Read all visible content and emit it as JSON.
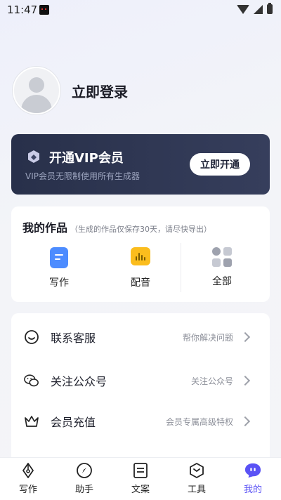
{
  "status_bar": {
    "time": "11:47"
  },
  "profile": {
    "login_label": "立即登录"
  },
  "vip": {
    "title": "开通VIP会员",
    "subtitle": "VIP会员无限制使用所有生成器",
    "button": "立即开通"
  },
  "works": {
    "title": "我的作品",
    "note": "（生成的作品仅保存30天，请尽快导出）",
    "items": [
      {
        "label": "写作",
        "icon": "document-icon"
      },
      {
        "label": "配音",
        "icon": "audio-wave-icon"
      },
      {
        "label": "全部",
        "icon": "grid-icon"
      }
    ]
  },
  "menu": {
    "items": [
      {
        "label": "联系客服",
        "hint": "帮你解决问题",
        "icon": "smile-chat-icon"
      },
      {
        "label": "关注公众号",
        "hint": "关注公众号",
        "icon": "wechat-icon"
      },
      {
        "label": "会员充值",
        "hint": "会员专属高级特权",
        "icon": "crown-icon"
      }
    ]
  },
  "tabbar": {
    "items": [
      {
        "label": "写作",
        "icon": "pen-nib-icon"
      },
      {
        "label": "助手",
        "icon": "compass-icon"
      },
      {
        "label": "文案",
        "icon": "document-lines-icon"
      },
      {
        "label": "工具",
        "icon": "hexagon-icon"
      },
      {
        "label": "我的",
        "icon": "profile-bubble-icon",
        "active": true
      }
    ]
  },
  "colors": {
    "accent": "#5a52f5",
    "vip_bg": "#2e3652",
    "write_icon": "#4d8cff",
    "dub_icon": "#fbbd1d"
  }
}
